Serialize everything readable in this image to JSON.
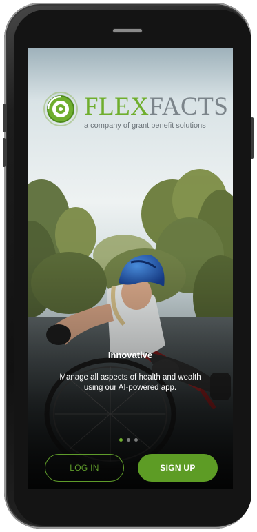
{
  "brand": {
    "name_part1": "FLEX",
    "name_part2": "FACTS",
    "tagline": "a company of grant benefit solutions",
    "primary_color": "#6fae2e",
    "secondary_color": "#7b848a"
  },
  "onboarding": {
    "slide_title": "Innovative",
    "slide_text": "Manage all aspects of health and wealth using our AI-powered app.",
    "pager": {
      "total_pages": 3,
      "active_page": 1
    },
    "hero_image": "wheelchair-athlete-photo"
  },
  "actions": {
    "login_label": "LOG IN",
    "signup_label": "SIGN UP"
  }
}
